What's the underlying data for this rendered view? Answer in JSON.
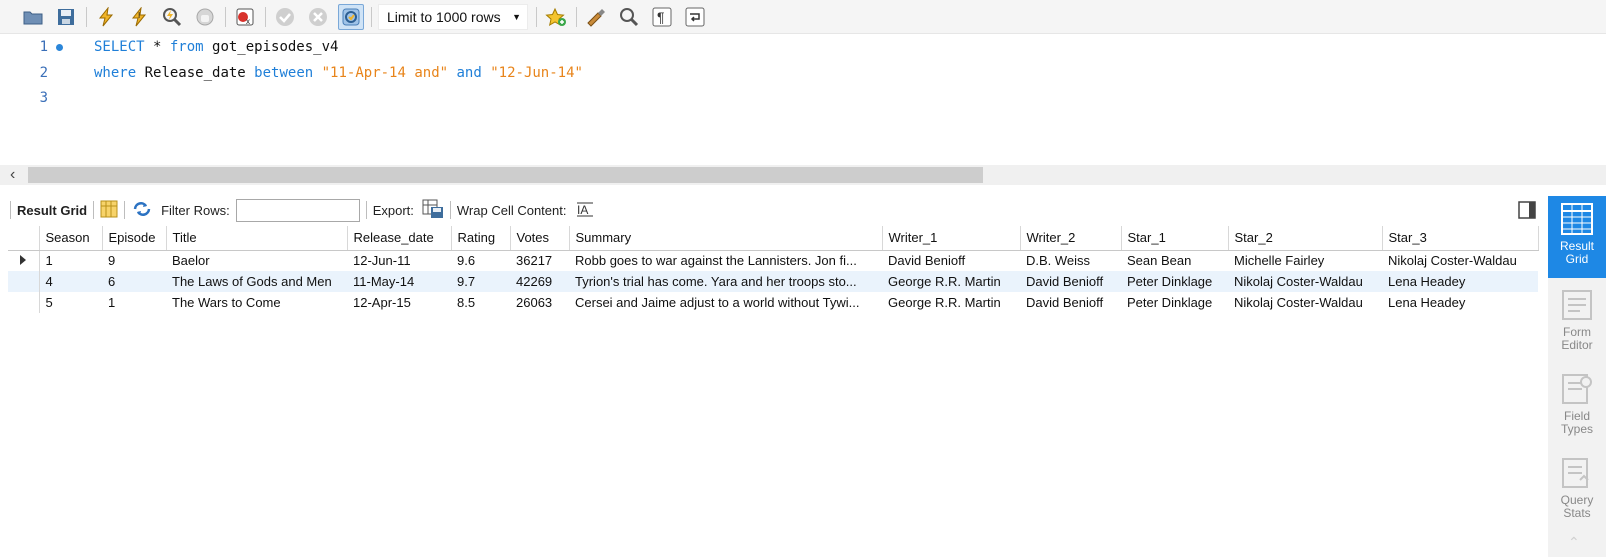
{
  "toolbar": {
    "icons": [
      "open-folder-icon",
      "save-icon",
      "execute-icon",
      "execute-current-icon",
      "explain-icon",
      "stop-icon",
      "toggle-error-icon",
      "commit-icon",
      "rollback-icon",
      "autocommit-icon",
      "add-snippet-icon",
      "beautify-icon",
      "find-icon",
      "invisible-chars-icon",
      "wrap-icon"
    ],
    "limit_label": "Limit to 1000 rows"
  },
  "editor": {
    "lines": [
      {
        "num": "1",
        "tokens": [
          {
            "t": "SELECT",
            "c": "kw"
          },
          {
            "t": " * ",
            "c": ""
          },
          {
            "t": "from",
            "c": "kw"
          },
          {
            "t": " got_episodes_v4",
            "c": ""
          }
        ]
      },
      {
        "num": "2",
        "tokens": [
          {
            "t": "where",
            "c": "kw"
          },
          {
            "t": " Release_date ",
            "c": ""
          },
          {
            "t": "between",
            "c": "kw"
          },
          {
            "t": " ",
            "c": ""
          },
          {
            "t": "\"11-Apr-14 and\"",
            "c": "str"
          },
          {
            "t": " ",
            "c": ""
          },
          {
            "t": "and",
            "c": "kw"
          },
          {
            "t": " ",
            "c": ""
          },
          {
            "t": "\"12-Jun-14\"",
            "c": "str"
          }
        ]
      },
      {
        "num": "3",
        "tokens": []
      }
    ]
  },
  "results_toolbar": {
    "result_grid_label": "Result Grid",
    "filter_label": "Filter Rows:",
    "filter_value": "",
    "export_label": "Export:",
    "wrap_label": "Wrap Cell Content:"
  },
  "grid": {
    "columns": [
      "Season",
      "Episode",
      "Title",
      "Release_date",
      "Rating",
      "Votes",
      "Summary",
      "Writer_1",
      "Writer_2",
      "Star_1",
      "Star_2",
      "Star_3"
    ],
    "rows": [
      [
        "1",
        "9",
        "Baelor",
        "12-Jun-11",
        "9.6",
        "36217",
        "Robb goes to war against the Lannisters. Jon fi...",
        "David Benioff",
        "D.B. Weiss",
        "Sean Bean",
        "Michelle Fairley",
        "Nikolaj Coster-Waldau"
      ],
      [
        "4",
        "6",
        "The Laws of Gods and Men",
        "11-May-14",
        "9.7",
        "42269",
        "Tyrion's trial has come. Yara and her troops sto...",
        "George R.R. Martin",
        "David Benioff",
        "Peter Dinklage",
        "Nikolaj Coster-Waldau",
        "Lena Headey"
      ],
      [
        "5",
        "1",
        "The Wars to Come",
        "12-Apr-15",
        "8.5",
        "26063",
        "Cersei and Jaime adjust to a world without Tywi...",
        "George R.R. Martin",
        "David Benioff",
        "Peter Dinklage",
        "Nikolaj Coster-Waldau",
        "Lena Headey"
      ]
    ]
  },
  "sidebar": {
    "items": [
      {
        "label": "Result Grid",
        "icon": "result-grid-icon",
        "active": true
      },
      {
        "label": "Form Editor",
        "icon": "form-editor-icon",
        "active": false
      },
      {
        "label": "Field Types",
        "icon": "field-types-icon",
        "active": false
      },
      {
        "label": "Query Stats",
        "icon": "query-stats-icon",
        "active": false
      }
    ]
  },
  "colors": {
    "accent": "#1e88e5",
    "keyword": "#1f7fd8",
    "string": "#e8841a"
  }
}
